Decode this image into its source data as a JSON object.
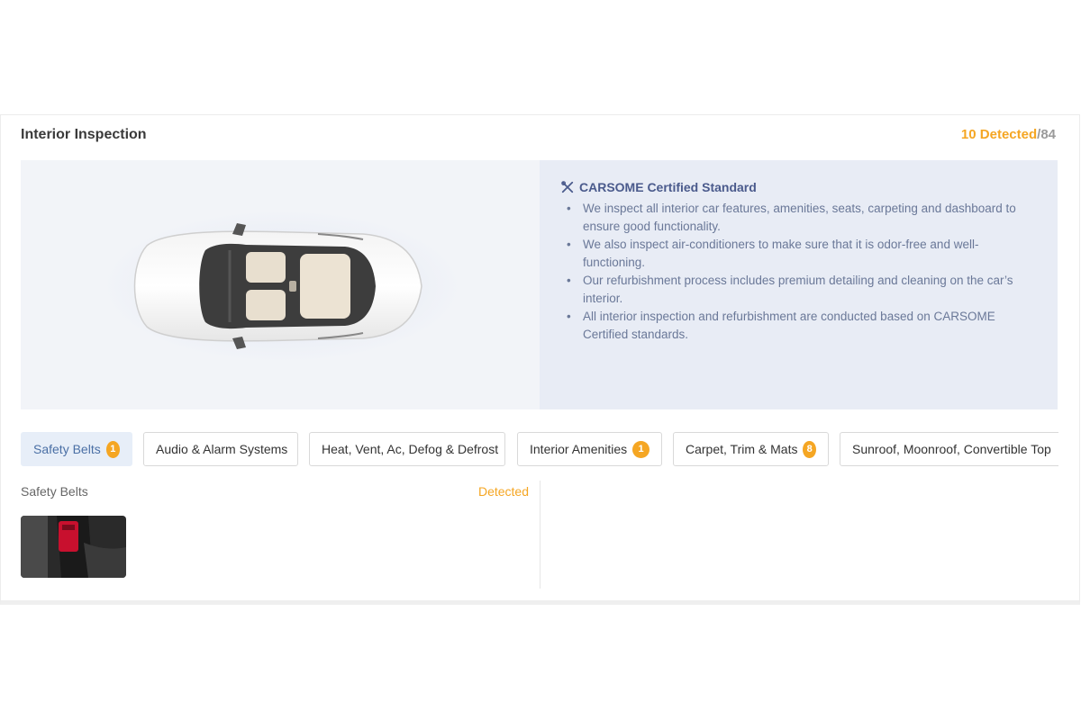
{
  "section": {
    "title": "Interior Inspection",
    "detected_label": "10 Detected",
    "separator": "/",
    "total": "84"
  },
  "info": {
    "title": "CARSOME Certified Standard",
    "icon": "tools-icon",
    "points": [
      "We inspect all interior car features, amenities, seats, carpeting and dashboard to ensure good functionality.",
      "We also inspect air-conditioners to make sure that it is odor-free and well-functioning.",
      "Our refurbishment process includes premium detailing and cleaning on the car’s interior.",
      "All interior inspection and refurbishment are conducted based on CARSOME Certified standards."
    ]
  },
  "tabs": [
    {
      "label": "Safety Belts",
      "badge": "1",
      "active": true
    },
    {
      "label": "Audio & Alarm Systems",
      "badge": null
    },
    {
      "label": "Heat, Vent, Ac, Defog & Defrost",
      "badge": null
    },
    {
      "label": "Interior Amenities",
      "badge": "1"
    },
    {
      "label": "Carpet, Trim & Mats",
      "badge": "8"
    },
    {
      "label": "Sunroof, Moonroof, Convertible Top",
      "badge": null
    }
  ],
  "detail": {
    "label": "Safety Belts",
    "status": "Detected"
  },
  "colors": {
    "accent_orange": "#f5a623",
    "info_bg": "#e8ecf5",
    "active_tab_bg": "#e7eef8",
    "info_text": "#6a7898"
  }
}
